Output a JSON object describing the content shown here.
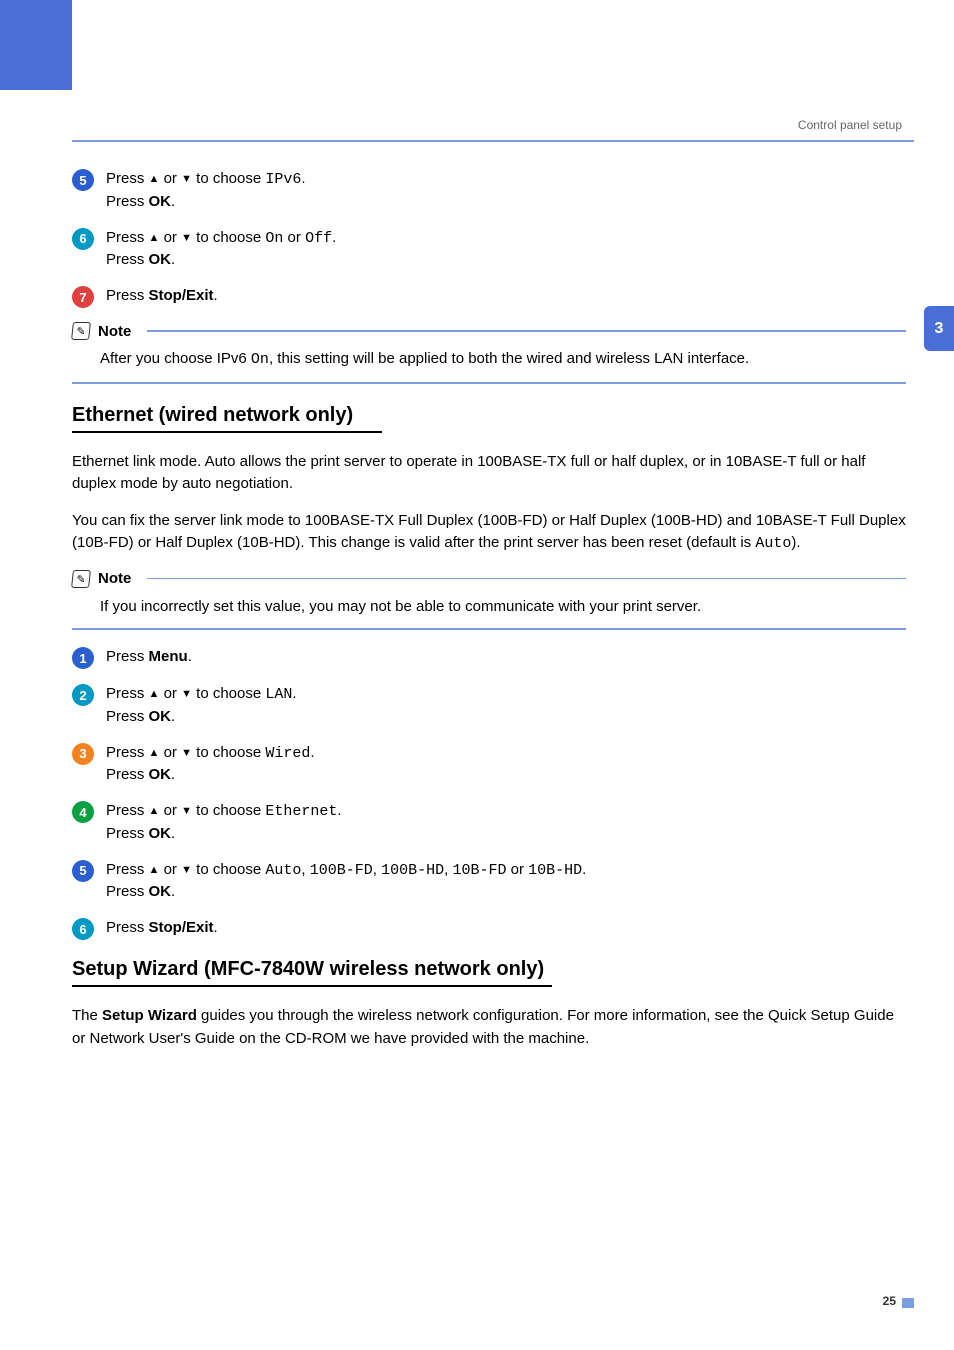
{
  "header": {
    "breadcrumb": "Control panel setup",
    "chapter_tab": "3"
  },
  "block1": {
    "steps": [
      {
        "n": "5",
        "pre": "Press ",
        "up": "▲",
        "mid": " or ",
        "down": "▼",
        "post": " to choose ",
        "code": "IPv6",
        "tail": ".",
        "ok": "Press ",
        "okb": "OK",
        "oktail": "."
      },
      {
        "n": "6",
        "pre": "Press ",
        "up": "▲",
        "mid": " or ",
        "down": "▼",
        "post": " to choose ",
        "code": "On",
        "mid2": " or ",
        "code2": "Off",
        "tail": ".",
        "ok": "Press ",
        "okb": "OK",
        "oktail": "."
      },
      {
        "n": "7",
        "pre": "Press ",
        "b": "Stop/Exit",
        "tail": "."
      }
    ],
    "note_label": "Note",
    "note_text_pre": "After you choose IPv6 ",
    "note_code": "On",
    "note_text_post": ", this setting will be applied to both the wired and wireless LAN interface."
  },
  "section_ethernet": {
    "title": "Ethernet (wired network only)",
    "p1": "Ethernet link mode. Auto allows the print server to operate in 100BASE-TX full or half duplex, or in 10BASE-T full or half duplex mode by auto negotiation.",
    "p2_pre": "You can fix the server link mode to 100BASE-TX Full Duplex (100B-FD) or Half Duplex (100B-HD) and 10BASE-T Full Duplex (10B-FD) or Half Duplex (10B-HD). This change is valid after the print server has been reset (default is ",
    "p2_code": "Auto",
    "p2_post": ").",
    "note_label": "Note",
    "note_text": "If you incorrectly set this value, you may not be able to communicate with your print server.",
    "steps": [
      {
        "n": "1",
        "pre": "Press ",
        "b": "Menu",
        "tail": "."
      },
      {
        "n": "2",
        "pre": "Press ",
        "up": "▲",
        "mid": " or ",
        "down": "▼",
        "post": " to choose ",
        "code": "LAN",
        "tail": ".",
        "ok": "Press ",
        "okb": "OK",
        "oktail": "."
      },
      {
        "n": "3",
        "pre": "Press ",
        "up": "▲",
        "mid": " or ",
        "down": "▼",
        "post": " to choose ",
        "code": "Wired",
        "tail": ".",
        "ok": "Press ",
        "okb": "OK",
        "oktail": "."
      },
      {
        "n": "4",
        "pre": "Press ",
        "up": "▲",
        "mid": " or ",
        "down": "▼",
        "post": " to choose ",
        "code": "Ethernet",
        "tail": ".",
        "ok": "Press ",
        "okb": "OK",
        "oktail": "."
      },
      {
        "n": "5",
        "pre": "Press ",
        "up": "▲",
        "mid": " or ",
        "down": "▼",
        "post": " to choose ",
        "code": "Auto",
        "sep1": ", ",
        "code2": "100B-FD",
        "sep2": ", ",
        "code3": "100B-HD",
        "sep3": ", ",
        "code4": "10B-FD",
        "sep4": " or ",
        "code5": "10B-HD",
        "tail": ".",
        "ok": "Press ",
        "okb": "OK",
        "oktail": "."
      },
      {
        "n": "6",
        "pre": "Press ",
        "b": "Stop/Exit",
        "tail": "."
      }
    ]
  },
  "section_wizard": {
    "title": "Setup Wizard (MFC-7840W wireless network only)",
    "p_pre": "The ",
    "p_bold": "Setup Wizard",
    "p_post": " guides you through the wireless network configuration. For more information, see the Quick Setup Guide or Network User's Guide on the CD-ROM we have provided with the machine."
  },
  "page_number": "25"
}
